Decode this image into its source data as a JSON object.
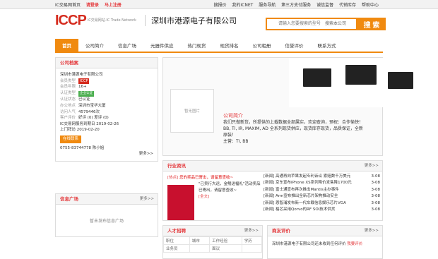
{
  "top": {
    "left": [
      "IC交易网首页",
      "请登录",
      "马上注册"
    ],
    "right": [
      "搜报价",
      "我的ICNET",
      "服务导航",
      "第三方支付服务",
      "诚信监督",
      "代销库存",
      "帮助中心"
    ]
  },
  "header": {
    "logo": "ICCP",
    "logo_sub": "IC交易网站·IC Trade Network",
    "company": "深圳市港源电子有限公司",
    "search_placeholder": "请输入您要搜索的型号",
    "search_scope": "搜索本公司",
    "search_btn": "搜 索"
  },
  "nav": [
    "首页",
    "公司简介",
    "信息广场",
    "元器件供应",
    "热门现货",
    "现货排名",
    "公司相册",
    "信誉评价",
    "联系方式"
  ],
  "archive": {
    "title": "公司档案",
    "rows": [
      [
        "深圳市港源电子有限公司",
        ""
      ],
      [
        "会员类型",
        "ICCP"
      ],
      [
        "会员年限",
        "16+"
      ],
      [
        "认证类型",
        "企业认证"
      ],
      [
        "认证状态",
        "已认证"
      ],
      [
        "办公地点",
        "深圳市宝华大厦"
      ],
      [
        "访问人气",
        "4579446次"
      ],
      [
        "客户评价",
        "好评 (0) 差评 (0)"
      ],
      [
        "IC交易网服务到期日",
        "2019-02-26"
      ],
      [
        "上门拜访",
        "2019-02-20"
      ]
    ],
    "contact_btn": "在线联系",
    "phone": "0755-83744778 陈小姐",
    "more": "更多>>"
  },
  "info_square": {
    "title": "信息广场",
    "more": "更多>>",
    "empty": "暂未发布信息广场"
  },
  "profile": {
    "placeholder": "暂无图片",
    "title": "公司简介",
    "text": "我们只做新货，所提供的上载数据全部属实，欢迎查询，预祝：合作愉快！BB, TI, IR, MAXIM, AD 全系列现货供应，现货库存现货，品质保证，全新原装！",
    "main": "主营：TI, BB"
  },
  "news": {
    "title": "行业资讯",
    "more": "更多>>",
    "hot_label": "[热点]",
    "hot_title": "您的奖品已寄出，请留意查收~",
    "hot_text": "\"已卖行大运，金鳍送福礼\"活动奖品已寄出，请留意查收~",
    "full": "[全文]",
    "items": [
      [
        "[新闻] 高通再向苹果发起专利诉讼 索赔数千万美元",
        "3-08"
      ],
      [
        "[新闻] 京东宣布iPhone XS系列降价发售降1700元",
        "3-08"
      ],
      [
        "[新闻] 富士通宣布再次推出Mantis主办事件",
        "3-08"
      ],
      [
        "[新闻] Arm宣布推出全新芯片架构推动安全",
        "3-08"
      ],
      [
        "[新闻] 恩智浦发布新一代车载信息娱乐芯片VGA",
        "3-08"
      ],
      [
        "[新闻] 格芯采用Qorvo的RF SOI技术供货",
        "3-08"
      ]
    ]
  },
  "jobs": {
    "title": "人才招聘",
    "more": "更多>>",
    "headers": [
      "职位",
      "城市",
      "工作经验",
      "学历"
    ],
    "rows": [
      [
        "业务员",
        "",
        "面议",
        ""
      ]
    ]
  },
  "reviews": {
    "title": "商友评价",
    "more": "更多>>",
    "text": "深圳市港源电子有限公司还未收到任何评价",
    "link": "我要评价"
  }
}
